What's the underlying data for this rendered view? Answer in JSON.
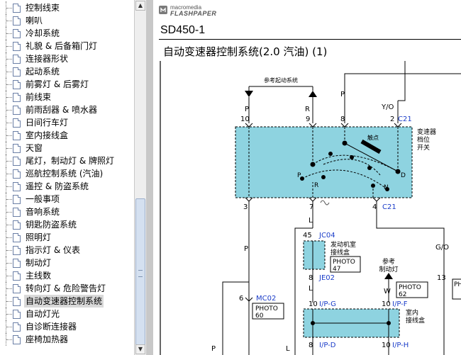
{
  "sidebar": {
    "items": [
      "控制线束",
      "喇叭",
      "冷却系统",
      "礼貌 & 后备箱门灯",
      "连接器形状",
      "起动系统",
      "前雾灯 & 后雾灯",
      "前线束",
      "前雨刮器 & 喷水器",
      "日间行车灯",
      "室内接线盒",
      "天窗",
      "尾灯，制动灯 & 牌照灯",
      "巡航控制系统 (汽油)",
      "遥控 & 防盗系统",
      "一般事项",
      "音响系统",
      "钥匙防盗系统",
      "照明灯",
      "指示灯 & 仪表",
      "制动灯",
      "主线数",
      "转向灯 & 危险警告灯",
      "自动变速器控制系统",
      "自动灯光",
      "自诊断连接器",
      "座椅加热器"
    ],
    "selected_index": 23
  },
  "scrollbar": {
    "up_glyph": "▲",
    "down_glyph": "▼",
    "thumb_position": 0.56
  },
  "viewer": {
    "brand_line1": "macromedia",
    "brand_line2": "FLASHPAPER",
    "doc_code": "SD450-1",
    "doc_title": "自动变速器控制系统(2.0  汽油) (1)"
  },
  "diagram": {
    "colors": {
      "component_fill": "#8ed3e0",
      "connector_blue": "#1a3cc8",
      "line": "#000000"
    },
    "ref_start_system": "参考起动系统",
    "wire_P": "P",
    "wire_R": "R",
    "wire_YO": "Y/O",
    "wire_L": "L",
    "wire_GO": "G/O",
    "wire_W": "W",
    "pin_10": "10",
    "pin_9": "9",
    "pin_8": "8",
    "pin_2": "2",
    "pin_3": "3",
    "pin_7": "7",
    "pin_4": "4",
    "pin_45": "45",
    "pin_6": "6",
    "pin_13": "13",
    "c21_top": "C21",
    "c21_bottom": "C21",
    "switch_label": [
      "变速器",
      "档位",
      "开关"
    ],
    "contact_label": "触点",
    "pos_P": "P",
    "pos_R": "R",
    "pos_N": "N",
    "pos_D": "D",
    "jc04": "JC04",
    "je02": "JE02",
    "engine_box_label": [
      "发动机室",
      "接线盒"
    ],
    "photo_47": [
      "PHOTO",
      "47"
    ],
    "ref_brake_lamp": [
      "参考",
      "制动灯"
    ],
    "photo_62": [
      "PHOTO",
      "62"
    ],
    "mc02": "MC02",
    "photo_60": [
      "PHOTO",
      "60"
    ],
    "ip_g": "I/P-G",
    "ip_f": "I/P-F",
    "ip_d": "I/P-D",
    "ip_h": "I/P-H",
    "interior_box_label": [
      "室内",
      "接线盒"
    ],
    "photo_edge": "PHOTO",
    "wire_L2": "L",
    "wire_P2": "P"
  }
}
